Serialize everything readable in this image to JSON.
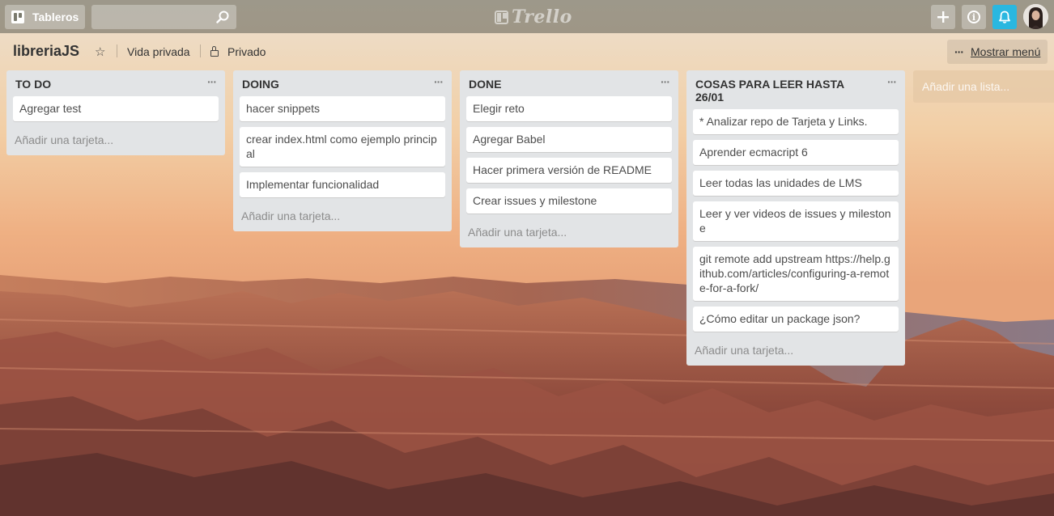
{
  "header": {
    "boards_label": "Tableros",
    "search_value": "",
    "search_placeholder": "",
    "logo_text": "Trello",
    "add_icon": "plus-icon",
    "info_icon": "info-icon",
    "bell_icon": "bell-icon",
    "accent_color": "#2ab7e0"
  },
  "board": {
    "name": "libreriaJS",
    "visibility": "Vida privada",
    "privacy": "Privado",
    "show_menu": "Mostrar menú"
  },
  "lists": [
    {
      "title": "TO DO",
      "cards": [
        "Agregar test"
      ],
      "add_card": "Añadir una tarjeta..."
    },
    {
      "title": "DOING",
      "cards": [
        "hacer snippets",
        "crear index.html como ejemplo principal",
        "Implementar funcionalidad"
      ],
      "add_card": "Añadir una tarjeta..."
    },
    {
      "title": "DONE",
      "cards": [
        "Elegir reto",
        "Agregar Babel",
        "Hacer primera versión de README",
        "Crear issues y milestone"
      ],
      "add_card": "Añadir una tarjeta..."
    },
    {
      "title": "COSAS PARA LEER HASTA 26/01",
      "cards": [
        "* Analizar repo de Tarjeta y Links.",
        "Aprender ecmacript 6",
        "Leer todas las unidades de LMS",
        "Leer y ver videos de issues y milestone",
        "git remote add upstream https://help.github.com/articles/configuring-a-remote-for-a-fork/",
        "¿Cómo editar un package json?"
      ],
      "add_card": "Añadir una tarjeta..."
    }
  ],
  "add_list": "Añadir una lista..."
}
